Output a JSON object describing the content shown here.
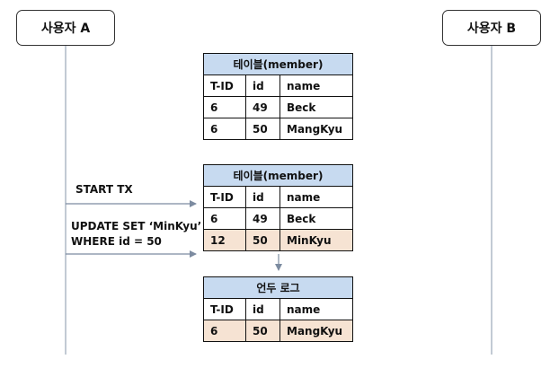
{
  "actors": {
    "a": "사용자 A",
    "b": "사용자 B"
  },
  "messages": {
    "start_tx": "START TX",
    "update_line1": "UPDATE SET ‘MinKyu’",
    "update_line2": "WHERE id = 50"
  },
  "tables": [
    {
      "caption": "테이블(member)",
      "headers": [
        "T-ID",
        "id",
        "name"
      ],
      "rows": [
        [
          "6",
          "49",
          "Beck"
        ],
        [
          "6",
          "50",
          "MangKyu"
        ]
      ]
    },
    {
      "caption": "테이블(member)",
      "headers": [
        "T-ID",
        "id",
        "name"
      ],
      "rows": [
        [
          "6",
          "49",
          "Beck"
        ],
        [
          "12",
          "50",
          "MinKyu"
        ]
      ]
    },
    {
      "caption": "언두 로그",
      "headers": [
        "T-ID",
        "id",
        "name"
      ],
      "rows": [
        [
          "6",
          "50",
          "MangKyu"
        ]
      ]
    }
  ],
  "colors": {
    "table_header": "#c7daf0",
    "highlight_row": "#f6e3d3",
    "lifeline": "#9aa7b8"
  }
}
